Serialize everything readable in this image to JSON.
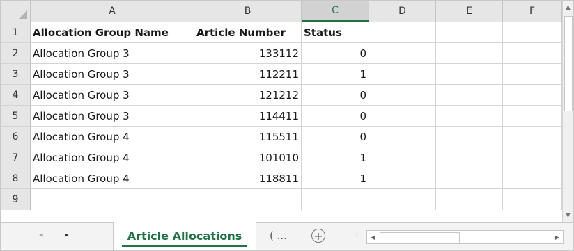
{
  "columns": [
    "A",
    "B",
    "C",
    "D",
    "E",
    "F"
  ],
  "selected_column": "C",
  "rows": [
    {
      "num": "1",
      "a": "Allocation Group Name",
      "b": "Article Number",
      "c": "Status"
    },
    {
      "num": "2",
      "a": "Allocation Group 3",
      "b": "133112",
      "c": "0"
    },
    {
      "num": "3",
      "a": "Allocation Group 3",
      "b": "112211",
      "c": "1"
    },
    {
      "num": "4",
      "a": "Allocation Group 3",
      "b": "121212",
      "c": "0"
    },
    {
      "num": "5",
      "a": "Allocation Group 3",
      "b": "114411",
      "c": "0"
    },
    {
      "num": "6",
      "a": "Allocation Group 4",
      "b": "115511",
      "c": "0"
    },
    {
      "num": "7",
      "a": "Allocation Group 4",
      "b": "101010",
      "c": "1"
    },
    {
      "num": "8",
      "a": "Allocation Group 4",
      "b": "118811",
      "c": "1"
    },
    {
      "num": "9",
      "a": "",
      "b": "",
      "c": ""
    }
  ],
  "tabs": {
    "active": "Article Allocations",
    "more": "( ...",
    "add": "+",
    "prev_arrow": "◂",
    "next_arrow": "▸"
  },
  "scroll": {
    "up": "▲",
    "down": "▼",
    "left": "◀",
    "right": "▶",
    "split": "⋮"
  },
  "colors": {
    "accent": "#217346"
  }
}
